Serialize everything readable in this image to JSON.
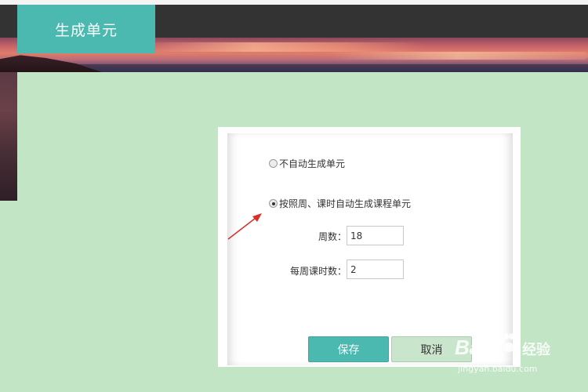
{
  "page": {
    "title": "生成单元"
  },
  "dialog": {
    "options": [
      {
        "label": "不自动生成单元",
        "checked": false
      },
      {
        "label": "按照周、课时自动生成课程单元",
        "checked": true
      }
    ],
    "fields": {
      "weeks": {
        "label": "周数：",
        "value": "18"
      },
      "hours_per_week": {
        "label": "每周课时数：",
        "value": "2"
      }
    },
    "buttons": {
      "save": "保存",
      "cancel": "取消"
    }
  },
  "colors": {
    "accent": "#4cb9b0",
    "background": "#c2e5c5",
    "header": "#333333",
    "arrow": "#d9302a"
  },
  "watermark": {
    "logo": "Bai",
    "logo_icon": "paw-icon",
    "cn": "经验",
    "url": "jingyan.baidu.com"
  }
}
